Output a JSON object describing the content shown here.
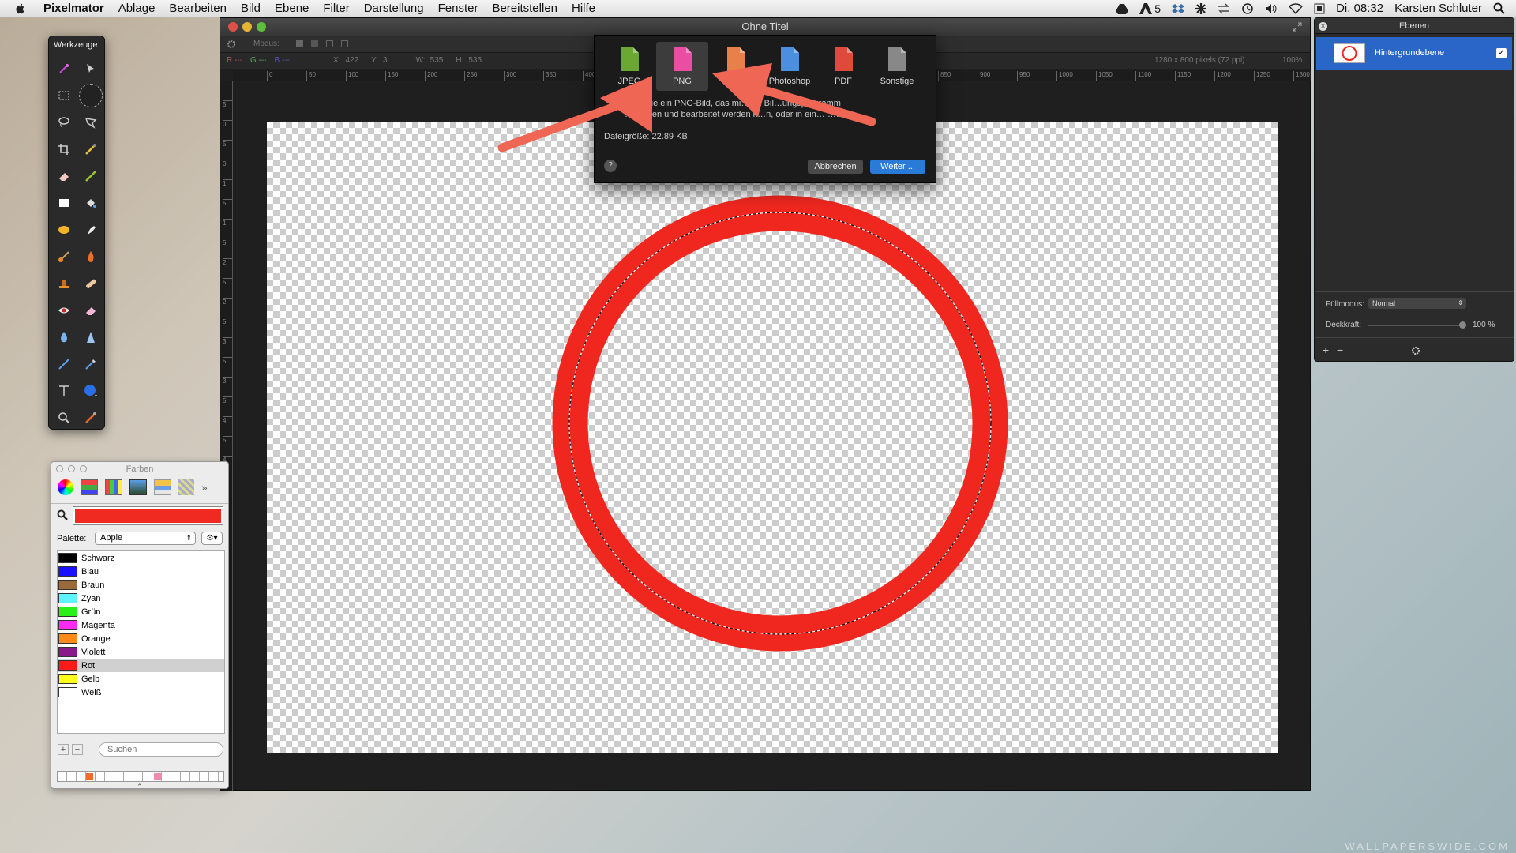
{
  "menubar": {
    "app": "Pixelmator",
    "items": [
      "Ablage",
      "Bearbeiten",
      "Bild",
      "Ebene",
      "Filter",
      "Darstellung",
      "Fenster",
      "Bereitstellen",
      "Hilfe"
    ],
    "status_count": "5",
    "clock": "Di. 08:32",
    "user": "Karsten Schluter"
  },
  "tools_palette": {
    "title": "Werkzeuge"
  },
  "window": {
    "title": "Ohne Titel",
    "options_bar": {
      "modus_label": "Modus:"
    },
    "info_bar": {
      "x_label": "X:",
      "x_value": "422",
      "y_label": "Y:",
      "y_value": "3",
      "w_label": "W:",
      "w_value": "535",
      "h_label": "H:",
      "h_value": "535",
      "doc_size": "1280 x 800 pixels (72 ppi)",
      "zoom": "100%"
    },
    "ruler_labels": [
      "0",
      "50",
      "100",
      "150",
      "200",
      "250",
      "300",
      "350",
      "400",
      "450",
      "500",
      "550",
      "600",
      "650",
      "700",
      "750",
      "800",
      "850",
      "900",
      "950",
      "1000",
      "1050",
      "1100",
      "1150",
      "1200",
      "1250",
      "1300"
    ],
    "vruler_labels": [
      "5",
      "0",
      "5",
      "0",
      "1",
      "5",
      "1",
      "5",
      "2",
      "5",
      "2",
      "5",
      "3",
      "5",
      "3",
      "5",
      "4",
      "5",
      "4"
    ]
  },
  "export_sheet": {
    "formats": [
      {
        "name": "JPEG",
        "icon": "jpeg-file-icon",
        "color": "#6aa832"
      },
      {
        "name": "PNG",
        "icon": "png-file-icon",
        "color": "#e84ea2"
      },
      {
        "name": "TIFF",
        "icon": "tiff-file-icon",
        "color": "#e8804a"
      },
      {
        "name": "Photoshop",
        "icon": "psd-file-icon",
        "color": "#4a8fe0"
      },
      {
        "name": "PDF",
        "icon": "pdf-file-icon",
        "color": "#e04a3a"
      },
      {
        "name": "Sonstige",
        "icon": "generic-file-icon",
        "color": "#888888"
      }
    ],
    "selected": "PNG",
    "desc_line1": "…en Sie ein PNG-Bild, das mi…em Bil…ungsprogramm",
    "desc_line2": "…esehen und bearbeitet werden k…n, oder in ein…  …wser",
    "file_size": "Dateigröße: 22.89 KB",
    "cancel": "Abbrechen",
    "next": "Weiter ..."
  },
  "layers": {
    "title": "Ebenen",
    "layer_name": "Hintergrundebene",
    "fill_label": "Füllmodus:",
    "fill_value": "Normal",
    "opacity_label": "Deckkraft:",
    "opacity_value": "100 %"
  },
  "colors": {
    "title": "Farben",
    "palette_label": "Palette:",
    "palette_value": "Apple",
    "search_placeholder": "Suchen",
    "current_color": "#f02a21",
    "items": [
      {
        "name": "Schwarz",
        "hex": "#000000"
      },
      {
        "name": "Blau",
        "hex": "#1a12ff"
      },
      {
        "name": "Braun",
        "hex": "#9a6a3a"
      },
      {
        "name": "Zyan",
        "hex": "#5ff5ff"
      },
      {
        "name": "Grün",
        "hex": "#2af01a"
      },
      {
        "name": "Magenta",
        "hex": "#ff2aef"
      },
      {
        "name": "Orange",
        "hex": "#ff8a1a"
      },
      {
        "name": "Violett",
        "hex": "#8a1a8a"
      },
      {
        "name": "Rot",
        "hex": "#ff1a1a"
      },
      {
        "name": "Gelb",
        "hex": "#ffff1a"
      },
      {
        "name": "Weiß",
        "hex": "#ffffff"
      }
    ],
    "selected": "Rot"
  },
  "canvas": {
    "ring_color": "#f0271f"
  },
  "watermark": "WALLPAPERSWIDE.COM"
}
